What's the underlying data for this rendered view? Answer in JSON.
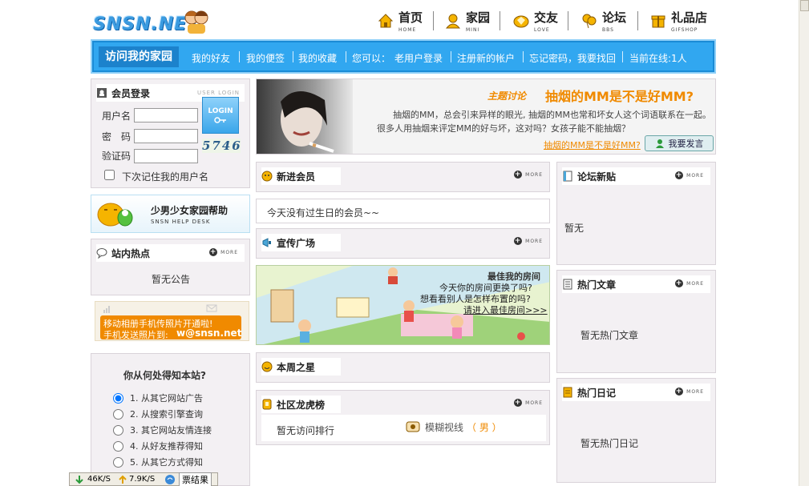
{
  "header": {
    "logo_text": "SNSN.NET",
    "nav": [
      {
        "zh": "首页",
        "en": "HOME"
      },
      {
        "zh": "家园",
        "en": "MINI"
      },
      {
        "zh": "交友",
        "en": "LOVE"
      },
      {
        "zh": "论坛",
        "en": "BBS"
      },
      {
        "zh": "礼品店",
        "en": "GIFSHOP"
      }
    ]
  },
  "menubar": {
    "home": "访问我的家园",
    "items": [
      "我的好友",
      "我的便签",
      "我的收藏"
    ],
    "you_can": "您可以：",
    "links": [
      "老用户登录",
      "注册新的帐户",
      "忘记密码，我要找回"
    ],
    "online": "当前在线:1人"
  },
  "login": {
    "title": "会员登录",
    "title_en": "USER LOGIN",
    "username_label": "用户名",
    "password_label": "密　码",
    "captcha_label": "验证码",
    "captcha_text": "5746",
    "button_text": "LOGIN",
    "remember_label": "下次记住我的用户名"
  },
  "helpdesk": {
    "title": "少男少女家园帮助",
    "subtitle": "SNSN HELP DESK"
  },
  "hot": {
    "title": "站内热点",
    "content": "暂无公告"
  },
  "mobile": {
    "line1": "移动相册手机传照片开通啦!",
    "line2": "手机发送照片到:",
    "email": "w@snsn.net"
  },
  "survey": {
    "title": "你从何处得知本站?",
    "options": [
      "1. 从其它网站广告",
      "2. 从搜索引擎查询",
      "3. 其它网站友情连接",
      "4. 从好友推荐得知",
      "5. 从其它方式得知"
    ],
    "selected_index": 0
  },
  "banner": {
    "topic_label": "主题讨论",
    "headline": "抽烟的MM是不是好MM?",
    "body1": "抽烟的MM，总会引来异样的眼光, 抽烟的MM也常和坏女人这个词语联系在一起。",
    "body2": "很多人用抽烟来评定MM的好与坏，这对吗？女孩子能不能抽烟？",
    "link": "抽烟的MM是不是好MM?",
    "post_button": "我要发言"
  },
  "new_members": {
    "title": "新进会员",
    "birthday_note": "今天没有过生日的会员~~"
  },
  "promo": {
    "title": "宣传广场",
    "room_title": "最佳我的房间",
    "room_q1": "今天你的房间更换了吗?",
    "room_q2": "想看看别人是怎样布置的吗?",
    "room_link": "请进入最佳房间>>>"
  },
  "weekly_star": {
    "title": "本周之星"
  },
  "ranking": {
    "title": "社区龙虎榜",
    "empty": "暂无访问排行",
    "user": "模糊视线",
    "gender": "（ 男 ）"
  },
  "forum": {
    "title": "论坛新贴",
    "content": "暂无"
  },
  "articles": {
    "title": "热门文章",
    "content": "暂无热门文章"
  },
  "diaries": {
    "title": "热门日记",
    "content": "暂无热门日记"
  },
  "more_label": "MORE",
  "statusbar": {
    "down": "46K/S",
    "up": "7.9K/S",
    "vote_text": "票结果"
  },
  "colors": {
    "accent_blue": "#31a7f0",
    "headline_orange": "#f08a00",
    "panel_bg": "#f3f0f3"
  }
}
